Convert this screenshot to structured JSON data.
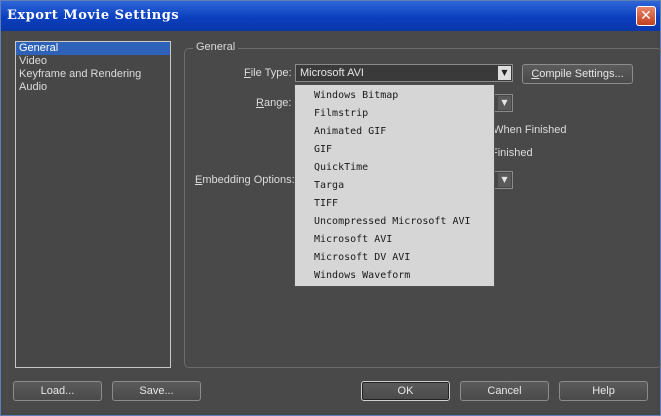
{
  "window": {
    "title": "Export Movie Settings",
    "close_glyph": "✕"
  },
  "nav": {
    "items": [
      {
        "label": "General",
        "selected": true
      },
      {
        "label": "Video",
        "selected": false
      },
      {
        "label": "Keyframe and Rendering",
        "selected": false
      },
      {
        "label": "Audio",
        "selected": false
      }
    ]
  },
  "general": {
    "legend": "General",
    "file_type": {
      "label_pre": "",
      "label_ul": "F",
      "label_post": "ile Type:",
      "value": "Microsoft AVI"
    },
    "compile_button": {
      "ul": "C",
      "rest": "ompile Settings..."
    },
    "range": {
      "label_ul": "R",
      "label_post": "ange:"
    },
    "partial_text_1": "t When Finished",
    "partial_text_2": "Finished",
    "embedding": {
      "label_ul": "E",
      "label_post": "mbedding Options:"
    }
  },
  "file_type_options": [
    "Windows Bitmap",
    "Filmstrip",
    "Animated GIF",
    "GIF",
    "QuickTime",
    "Targa",
    "TIFF",
    "Uncompressed Microsoft AVI",
    "Microsoft AVI",
    "Microsoft DV AVI",
    "Windows Waveform"
  ],
  "buttons": {
    "load": "Load...",
    "save": "Save...",
    "ok": "OK",
    "cancel": "Cancel",
    "help": "Help"
  },
  "colors": {
    "titlebar": "#0b3fbf",
    "selection": "#2d62b8",
    "background": "#494949",
    "dropdown_bg": "#d6d6d6"
  }
}
